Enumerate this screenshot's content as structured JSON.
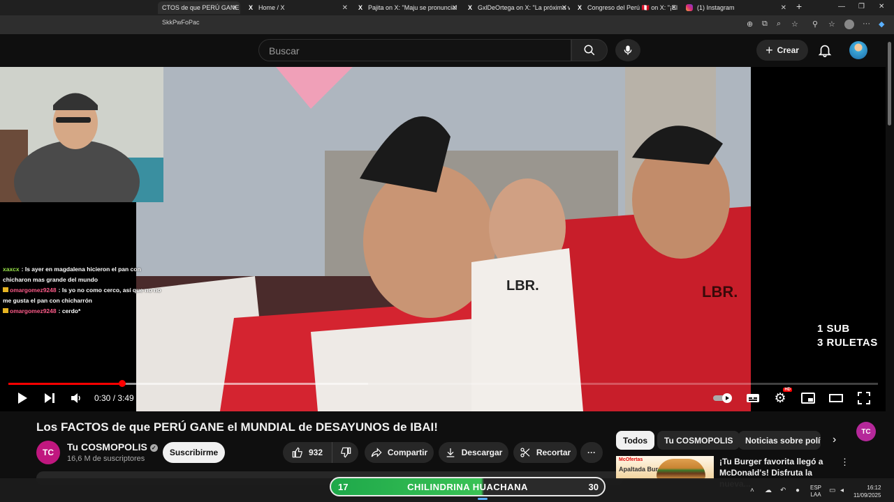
{
  "browser": {
    "tabs": [
      {
        "label": "CTOS de que PERÚ GANE e",
        "icon": "youtube-icon"
      },
      {
        "label": "Home / X",
        "icon": "x-icon"
      },
      {
        "label": "Pajita on X: \"Maju se pronuncia!",
        "icon": "x-icon"
      },
      {
        "label": "GxlDeOrtega on X: \"La próxima v",
        "icon": "x-icon"
      },
      {
        "label": "Congreso del Perú 🇵🇪 on X: \"¡El C",
        "icon": "x-icon"
      },
      {
        "label": "(1) Instagram",
        "icon": "instagram-icon"
      }
    ],
    "url": "SkkPwFoPac",
    "x_glyph": "X",
    "window_controls": [
      "—",
      "❐",
      "✕"
    ]
  },
  "youtube": {
    "search_placeholder": "Buscar",
    "create_label": "Crear"
  },
  "video": {
    "current_time": "0:30",
    "duration": "3:49",
    "time_display": "0:30 / 3:49",
    "played_fraction": 0.131,
    "buffered_fraction": 0.414,
    "hd_badge": "HD"
  },
  "overlay": {
    "chat": [
      {
        "user": "xaxcx",
        "user_color": "#9ae64a",
        "text": "Is ayer en magdalena hicieron el pan con chicharon mas grande del mundo"
      },
      {
        "user": "omargomez9248",
        "user_color": "#ff5c8a",
        "text": "Is yo no como cerco, así que no no me gusta el pan con chicharrón"
      },
      {
        "user": "omargomez9248",
        "user_color": "#ff5c8a",
        "text": "cerdo*"
      }
    ],
    "promo_line1": "1 SUB",
    "promo_line2": "3 RULETAS",
    "ruleta": {
      "left": "17",
      "label": "CHILINDRINA HUACHANA",
      "right": "30"
    },
    "tc_logo": "TC"
  },
  "details": {
    "title": "Los FACTOS de que PERÚ GANE el MUNDIAL de DESAYUNOS de IBAI!",
    "channel_name": "Tu COSMOPOLIS",
    "channel_avatar": "TC",
    "subscribers": "16,6 M de suscriptores",
    "subscribe_label": "Suscribirme",
    "likes": "932",
    "share_label": "Compartir",
    "download_label": "Descargar",
    "clip_label": "Recortar",
    "more_label": "···"
  },
  "sidebar": {
    "chips": [
      "Todos",
      "Tu COSMOPOLIS",
      "Noticias sobre polític"
    ],
    "ad": {
      "thumb_brand": "McOfertas",
      "thumb_text": "Apaltada Burger",
      "title": "¡Tu Burger favorita llegó a McDonald's! Disfruta la nueva..."
    }
  },
  "taskbar": {
    "lang_line1": "ESP",
    "lang_line2": "LAA",
    "time": "16:12",
    "date": "11/09/2025"
  },
  "colors": {
    "accent_red": "#ff0000",
    "background": "#0f0f0f",
    "chip_bg": "#272727"
  }
}
